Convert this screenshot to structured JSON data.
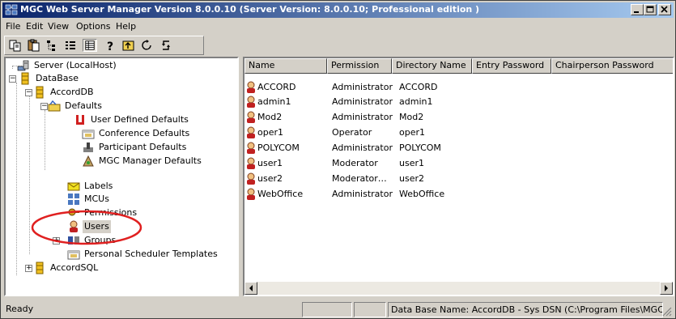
{
  "window": {
    "title": "MGC Web Server Manager Version 8.0.0.10  (Server Version: 8.0.0.10;  Professional edition )",
    "controls": [
      "minimize",
      "maximize",
      "close"
    ]
  },
  "menu": [
    "File",
    "Edit",
    "View",
    "Options",
    "Help"
  ],
  "toolbar": {
    "icons": [
      "copy-icon",
      "paste-icon",
      "tree-view-icon",
      "list-view-icon",
      "details-view-icon",
      "help-icon",
      "up-folder-icon",
      "refresh-icon",
      "sync-icon"
    ]
  },
  "tree": {
    "server": "Server (LocalHost)",
    "database": "DataBase",
    "accorddb": "AccordDB",
    "defaults": "Defaults",
    "user_defined_defaults": "User Defined Defaults",
    "conference_defaults": "Conference Defaults",
    "participant_defaults": "Participant Defaults",
    "mgc_manager_defaults": "MGC Manager Defaults",
    "labels": "Labels",
    "mcus": "MCUs",
    "permissions": "Permissions",
    "users": "Users",
    "groups": "Groups",
    "personal_scheduler_templates": "Personal Scheduler Templates",
    "accordsql": "AccordSQL",
    "selected": "Users"
  },
  "list": {
    "columns": [
      "Name",
      "Permission",
      "Directory Name",
      "Entry Password",
      "Chairperson Password"
    ],
    "rows": [
      {
        "name": "ACCORD",
        "permission": "Administrator",
        "directory": "ACCORD"
      },
      {
        "name": "admin1",
        "permission": "Administrator",
        "directory": "admin1"
      },
      {
        "name": "Mod2",
        "permission": "Administrator",
        "directory": "Mod2"
      },
      {
        "name": "oper1",
        "permission": "Operator",
        "directory": "oper1"
      },
      {
        "name": "POLYCOM",
        "permission": "Administrator",
        "directory": "POLYCOM"
      },
      {
        "name": "user1",
        "permission": "Moderator",
        "directory": "user1"
      },
      {
        "name": "user2",
        "permission": "Moderator…",
        "directory": "user2"
      },
      {
        "name": "WebOffice",
        "permission": "Administrator",
        "directory": "WebOffice"
      }
    ]
  },
  "status": {
    "ready": "Ready",
    "db_info": "Data Base Name: AccordDB - Sys DSN (C:\\Program Files\\MGC V"
  },
  "colors": {
    "title_start": "#0a246a",
    "title_end": "#a6caf0",
    "annotation": "#e02020",
    "face": "#d4d0c8"
  }
}
